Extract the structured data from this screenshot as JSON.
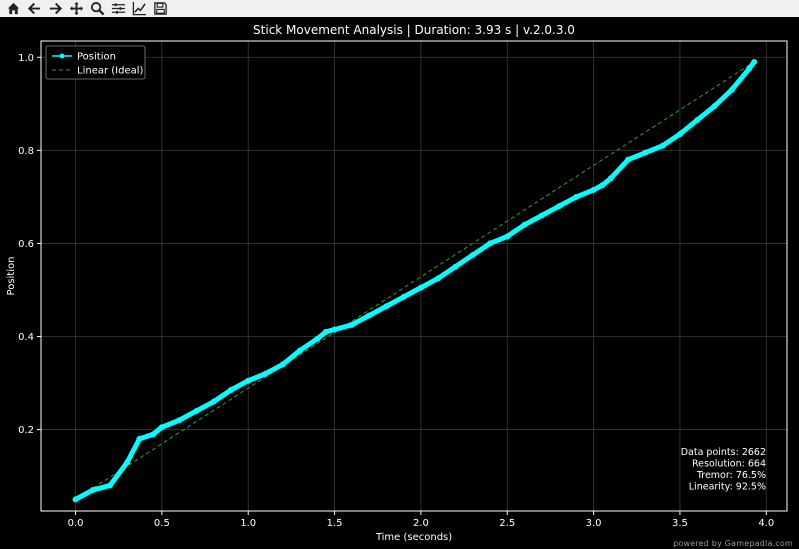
{
  "toolbar": {
    "items": [
      {
        "name": "home-icon",
        "title": "Home"
      },
      {
        "name": "back-arrow-icon",
        "title": "Back"
      },
      {
        "name": "forward-arrow-icon",
        "title": "Forward"
      },
      {
        "name": "pan-icon",
        "title": "Pan"
      },
      {
        "name": "zoom-icon",
        "title": "Zoom"
      },
      {
        "name": "configure-subplots-icon",
        "title": "Configure subplots"
      },
      {
        "name": "edit-axis-icon",
        "title": "Edit axis"
      },
      {
        "name": "save-icon",
        "title": "Save"
      }
    ]
  },
  "footer": {
    "text": "powered by Gamepadla.com"
  },
  "colors": {
    "position": "#00ffff",
    "linear": "#2ca02c",
    "grid": "#3a3a3a",
    "axes": "#ffffff"
  },
  "chart_data": {
    "type": "line",
    "title": "Stick Movement Analysis | Duration: 3.93 s | v.2.0.3.0",
    "xlabel": "Time (seconds)",
    "ylabel": "Position",
    "xlim": [
      -0.2,
      4.12
    ],
    "ylim": [
      0.025,
      1.035
    ],
    "xticks": [
      0.0,
      0.5,
      1.0,
      1.5,
      2.0,
      2.5,
      3.0,
      3.5,
      4.0
    ],
    "xtick_labels": [
      "0.0",
      "0.5",
      "1.0",
      "1.5",
      "2.0",
      "2.5",
      "3.0",
      "3.5",
      "4.0"
    ],
    "yticks": [
      0.2,
      0.4,
      0.6,
      0.8,
      1.0
    ],
    "ytick_labels": [
      "0.2",
      "0.4",
      "0.6",
      "0.8",
      "1.0"
    ],
    "grid": true,
    "legend_position": "top-left",
    "series": [
      {
        "name": "Position",
        "style": "line-markers",
        "x": [
          0.0,
          0.1,
          0.2,
          0.3,
          0.37,
          0.45,
          0.5,
          0.6,
          0.7,
          0.8,
          0.9,
          1.0,
          1.1,
          1.2,
          1.3,
          1.4,
          1.45,
          1.5,
          1.6,
          1.7,
          1.8,
          1.9,
          2.0,
          2.1,
          2.2,
          2.3,
          2.4,
          2.5,
          2.6,
          2.7,
          2.8,
          2.9,
          3.0,
          3.05,
          3.1,
          3.2,
          3.3,
          3.4,
          3.5,
          3.6,
          3.7,
          3.8,
          3.9,
          3.93
        ],
        "y": [
          0.05,
          0.07,
          0.08,
          0.13,
          0.18,
          0.19,
          0.205,
          0.22,
          0.24,
          0.26,
          0.285,
          0.305,
          0.32,
          0.34,
          0.37,
          0.395,
          0.41,
          0.415,
          0.425,
          0.445,
          0.465,
          0.485,
          0.505,
          0.525,
          0.55,
          0.575,
          0.6,
          0.615,
          0.64,
          0.66,
          0.68,
          0.7,
          0.715,
          0.725,
          0.74,
          0.78,
          0.795,
          0.81,
          0.835,
          0.865,
          0.895,
          0.93,
          0.975,
          0.99
        ]
      },
      {
        "name": "Linear (Ideal)",
        "style": "dashed",
        "x": [
          0.0,
          3.93
        ],
        "y": [
          0.05,
          0.99
        ]
      }
    ],
    "annotations": [
      "Data points: 2662",
      "Resolution: 664",
      "Tremor: 76.5%",
      "Linearity: 92.5%"
    ]
  }
}
